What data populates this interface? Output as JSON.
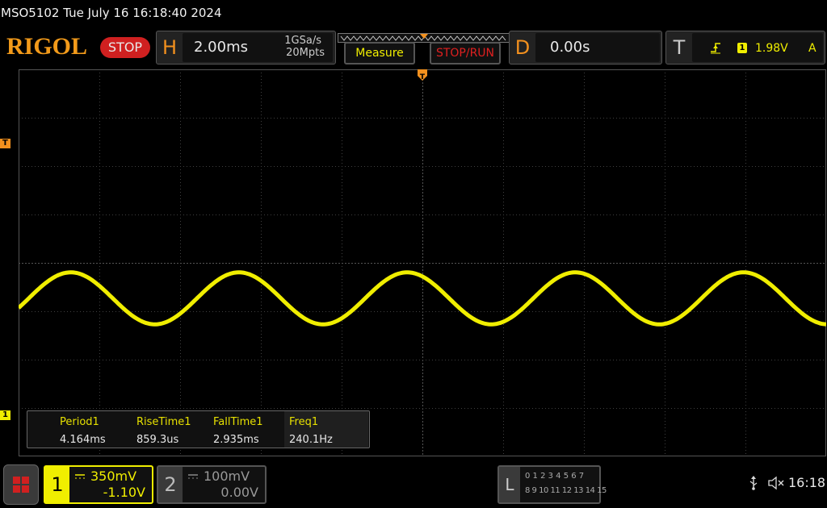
{
  "title_line": "MSO5102  Tue July 16 16:18:40 2024",
  "brand": "RIGOL",
  "run_state": "STOP",
  "horizontal": {
    "letter": "H",
    "timebase": "2.00ms",
    "sample_rate": "1GSa/s",
    "memory_depth": "20Mpts"
  },
  "buttons": {
    "measure": "Measure",
    "stop_run": "STOP/RUN"
  },
  "delay": {
    "letter": "D",
    "value": "0.00s"
  },
  "trigger": {
    "letter": "T",
    "channel": "1",
    "level": "1.98V",
    "mode": "A"
  },
  "markers": {
    "trigger": "T",
    "channel1": "1"
  },
  "measurements": [
    {
      "name": "Period1",
      "value": "4.164ms"
    },
    {
      "name": "RiseTime1",
      "value": "859.3us"
    },
    {
      "name": "FallTime1",
      "value": "2.935ms"
    },
    {
      "name": "Freq1",
      "value": "240.1Hz"
    }
  ],
  "channels": [
    {
      "number": "1",
      "scale": "350mV",
      "offset": "-1.10V",
      "active": true
    },
    {
      "number": "2",
      "scale": "100mV",
      "offset": "0.00V",
      "active": false
    }
  ],
  "logic": {
    "letter": "L",
    "row1": "0 1 2 3  4 5 6 7",
    "row2": "8 9 10 11 12 13 14 15"
  },
  "clock": "16:18",
  "colors": {
    "ch1": "#f0ee00",
    "accent": "#f2901e",
    "stop": "#d02020",
    "grid": "#404040"
  },
  "waveform": {
    "frequency_hz": 240.1,
    "timebase_s_per_div": 0.002
  }
}
